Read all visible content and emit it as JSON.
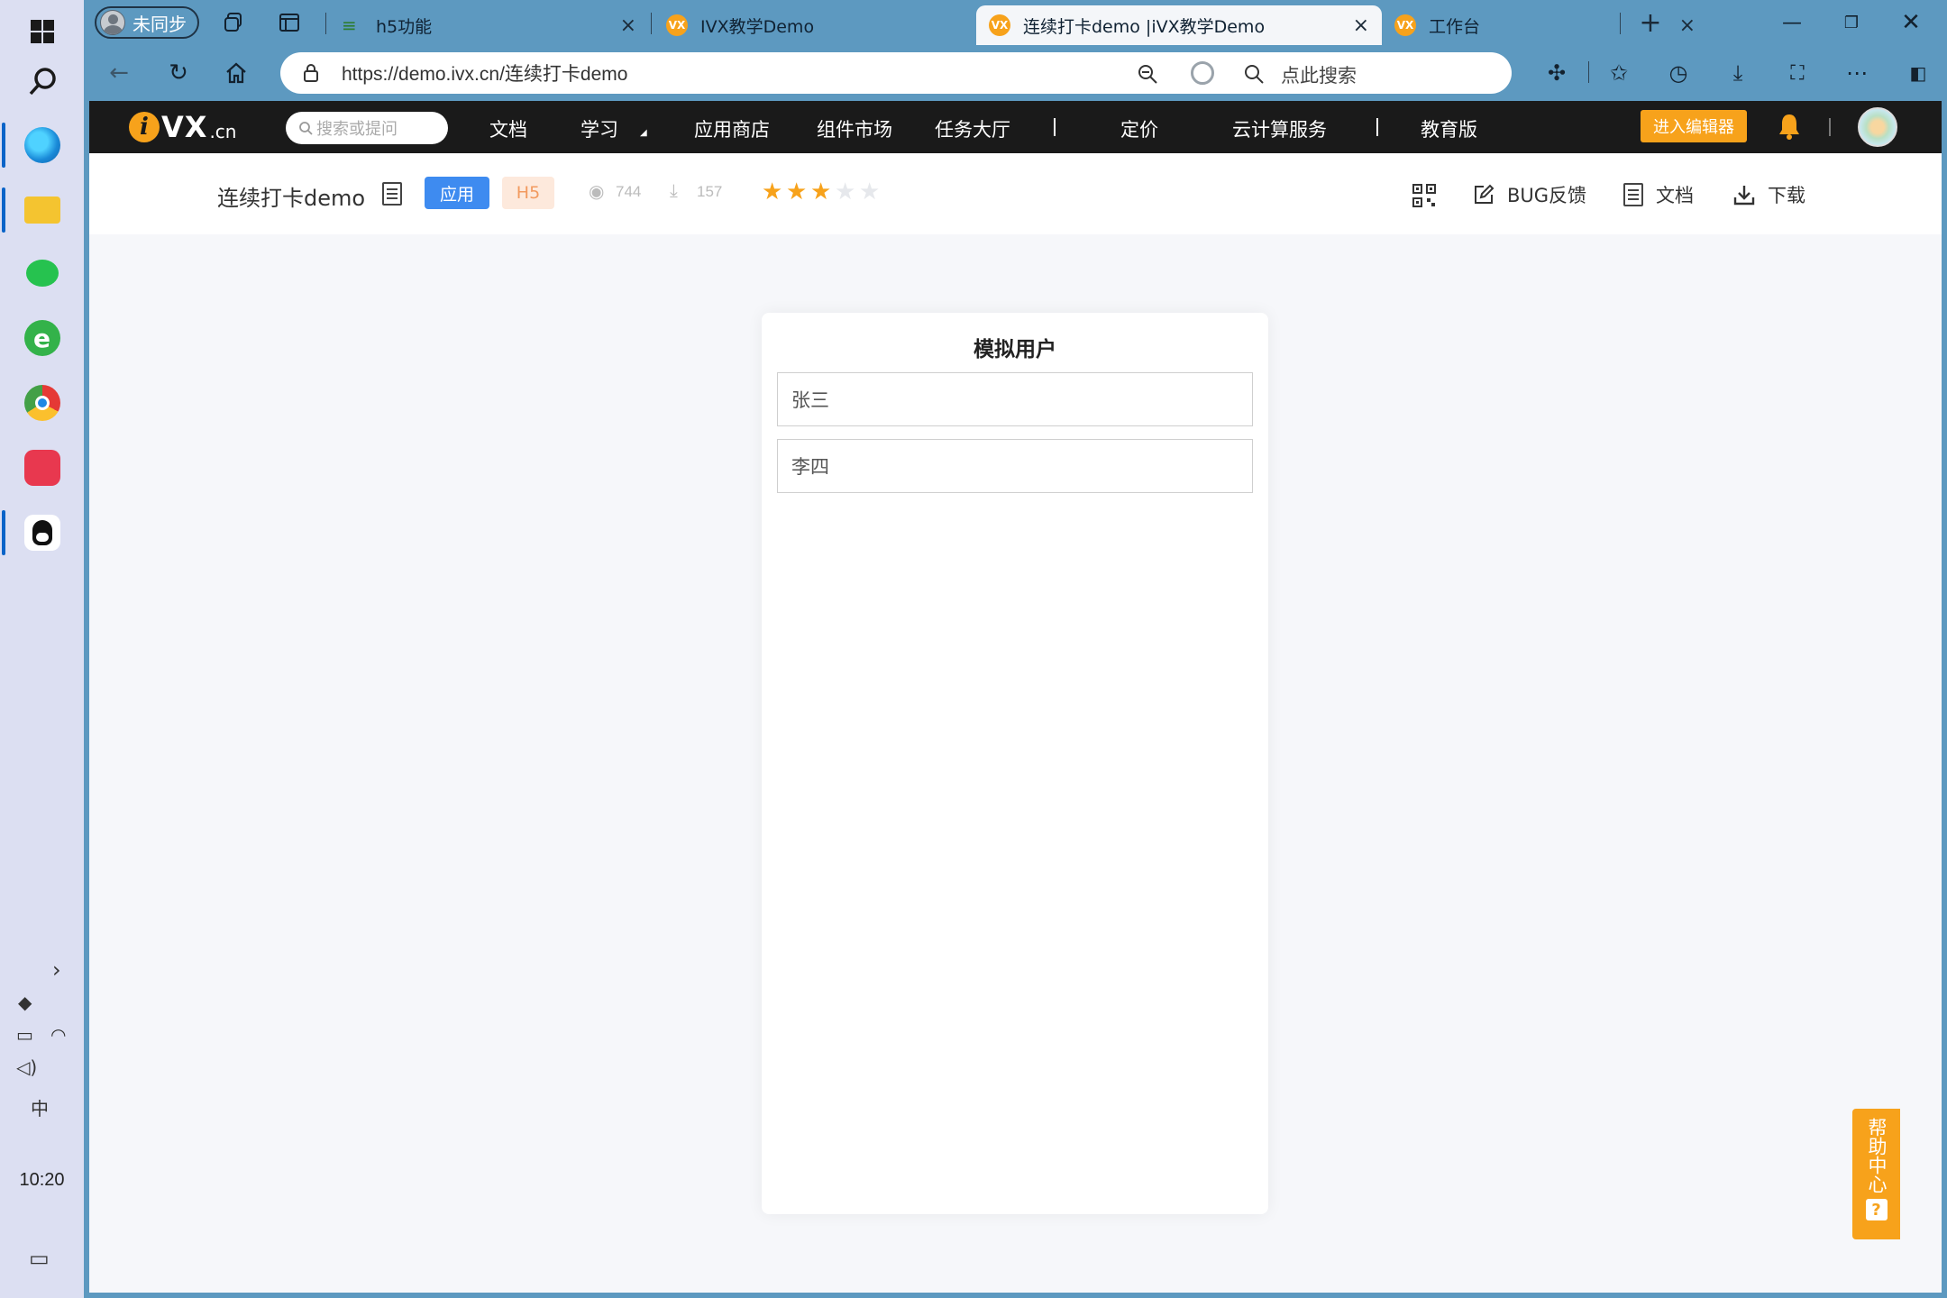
{
  "taskbar": {
    "time": "10:20",
    "ime": "中"
  },
  "browser": {
    "profile_label": "未同步",
    "tabs": [
      {
        "title": "h5功能"
      },
      {
        "title": "IVX教学Demo"
      },
      {
        "title": "连续打卡demo |iVX教学Demo"
      },
      {
        "title": "工作台"
      }
    ],
    "url": "https://demo.ivx.cn/连续打卡demo",
    "search_placeholder": "点此搜索"
  },
  "site": {
    "logo_cn": ".cn",
    "search_placeholder": "搜索或提问",
    "nav": [
      "文档",
      "学习",
      "应用商店",
      "组件市场",
      "任务大厅",
      "定价",
      "云计算服务",
      "教育版"
    ],
    "editor_button": "进入编辑器"
  },
  "app": {
    "title": "连续打卡demo",
    "badge_type": "应用",
    "badge_platform": "H5",
    "views": "744",
    "downloads": "157",
    "rating": 3,
    "rating_max": 5,
    "actions": {
      "bug": "BUG反馈",
      "docs": "文档",
      "download": "下载"
    }
  },
  "phone": {
    "title": "模拟用户",
    "users": [
      "张三",
      "李四"
    ]
  },
  "help": {
    "label": "帮助中心"
  },
  "colors": {
    "accent": "#f7a21b",
    "badge_blue": "#3e8bf0",
    "chrome": "#5d99c0"
  }
}
